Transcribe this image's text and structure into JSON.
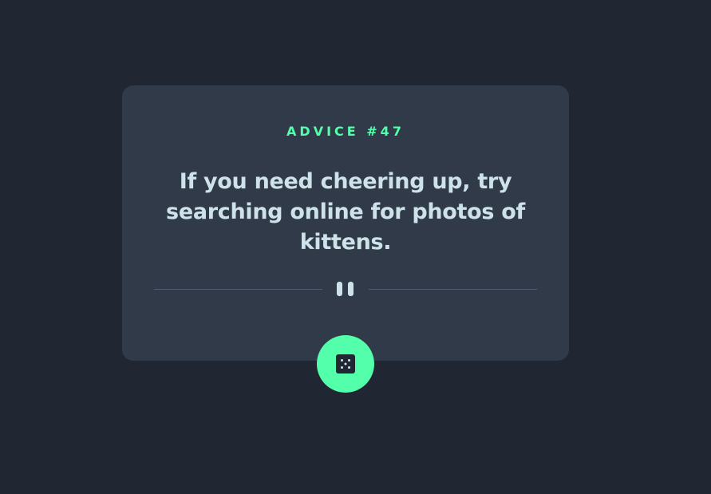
{
  "advice": {
    "id_label": "ADVICE #47",
    "text": "If you need cheering up, try searching online for photos of kittens."
  },
  "icons": {
    "divider": "pause-icon",
    "button": "dice-icon"
  },
  "colors": {
    "background": "#202632",
    "card": "#313a49",
    "accent": "#53ffaa",
    "text": "#cee3e9",
    "divider": "#4f5d74"
  }
}
